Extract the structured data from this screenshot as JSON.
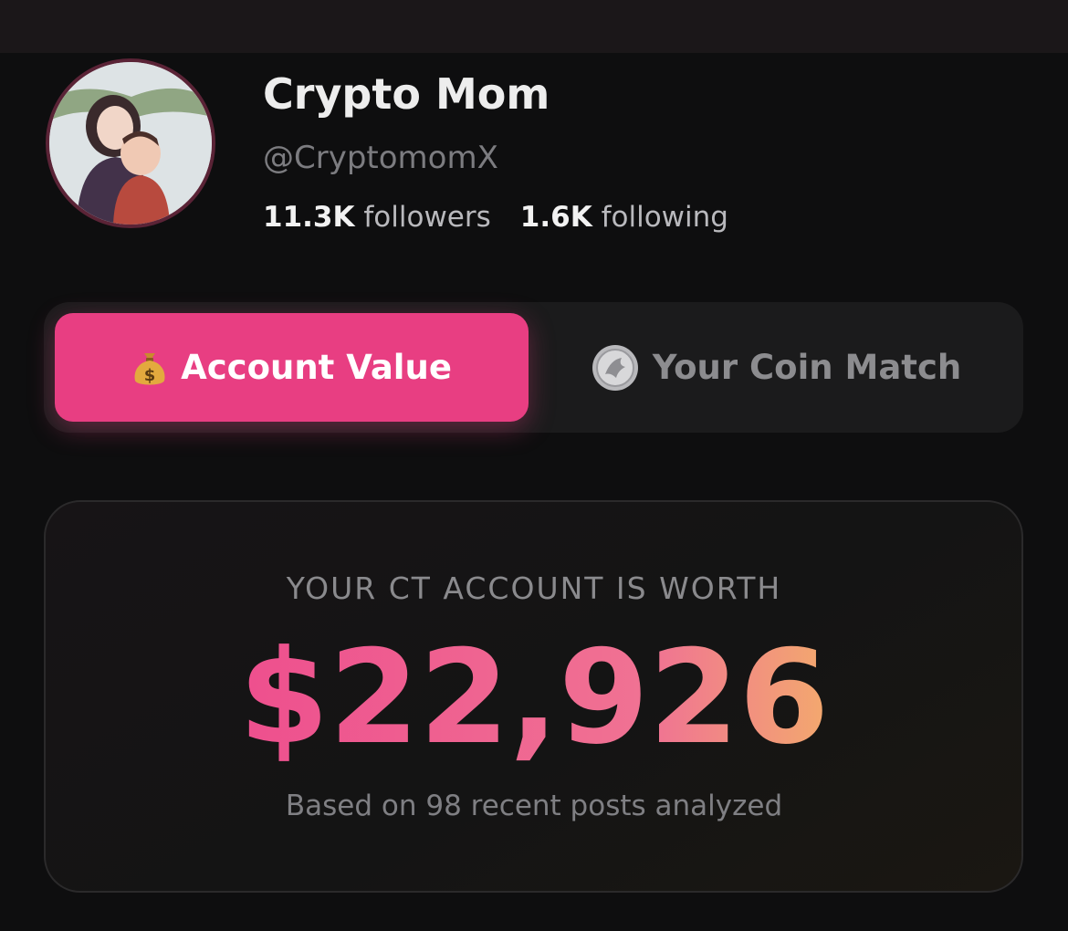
{
  "profile": {
    "name": "Crypto Mom",
    "handle": "@CryptomomX",
    "followers_count": "11.3K",
    "followers_label": "followers",
    "following_count": "1.6K",
    "following_label": "following"
  },
  "tabs": [
    {
      "label": "Account Value",
      "icon": "money-bag-icon",
      "active": true
    },
    {
      "label": "Your Coin Match",
      "icon": "coin-icon",
      "active": false
    }
  ],
  "card": {
    "label": "YOUR CT ACCOUNT IS WORTH",
    "amount": "$22,926",
    "note": "Based on 98 recent posts analyzed"
  },
  "colors": {
    "accent": "#e83e82",
    "amount_gradient_start": "#ee4f8e",
    "amount_gradient_end": "#f3a96e",
    "background": "#0e0e0f"
  }
}
